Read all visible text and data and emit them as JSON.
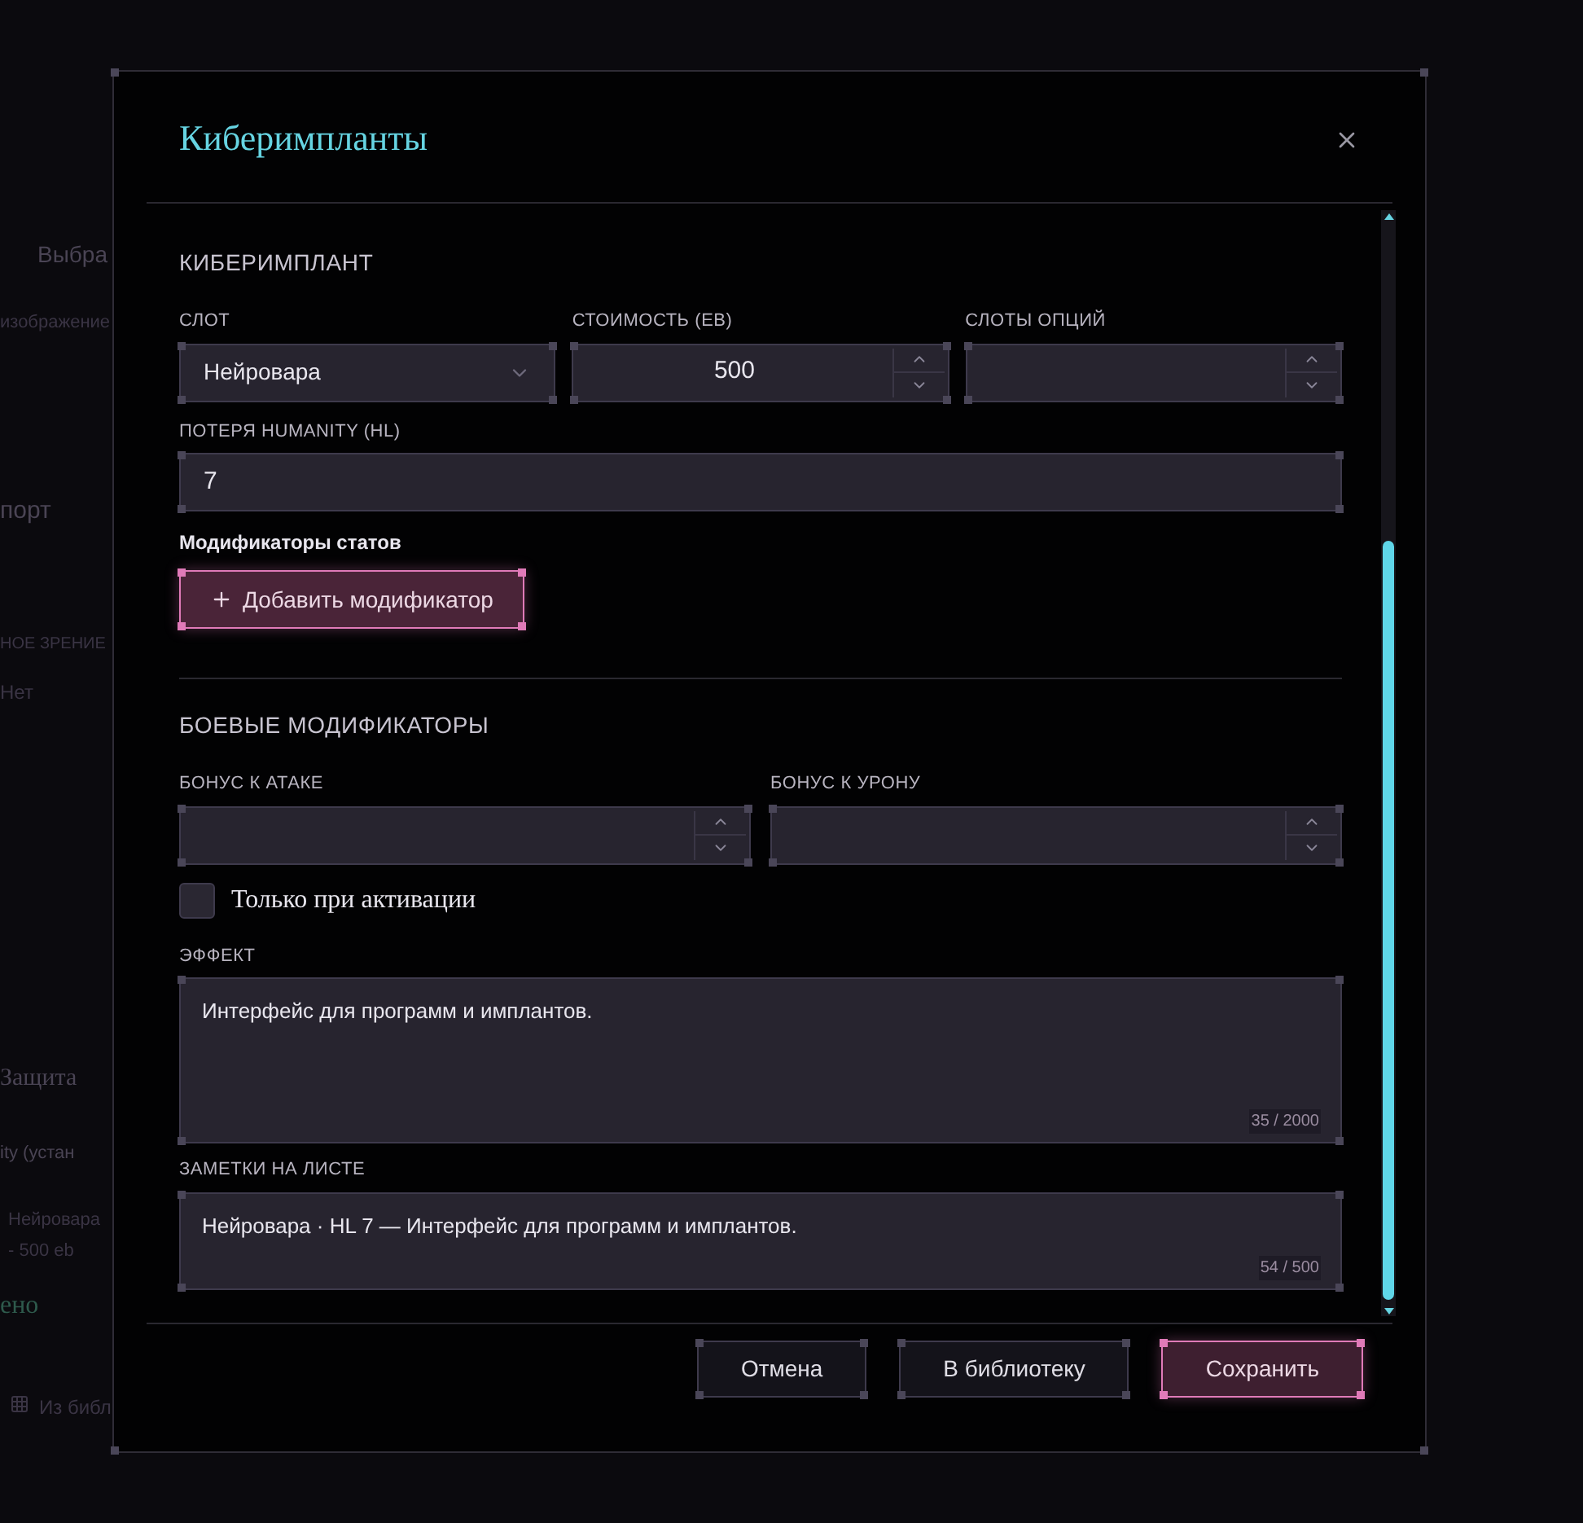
{
  "background": {
    "texts": [
      {
        "text": "Выбра"
      },
      {
        "text": "изображение"
      },
      {
        "text": "порт"
      },
      {
        "text": "НОЕ ЗРЕНИЕ"
      },
      {
        "text": "Нет"
      },
      {
        "text": "Защита"
      },
      {
        "text": "ity (устан"
      },
      {
        "text": "Нейровара"
      },
      {
        "text": "- 500 eb"
      },
      {
        "text": "ено"
      },
      {
        "text": "Из библ"
      }
    ]
  },
  "dialog": {
    "title": "Киберимпланты"
  },
  "implant": {
    "heading": "КИБЕРИМПЛАНТ",
    "slot": {
      "label": "СЛОТ",
      "value": "Нейровара"
    },
    "cost": {
      "label": "СТОИМОСТЬ (EB)",
      "value": "500"
    },
    "option_slots": {
      "label": "СЛОТЫ ОПЦИЙ"
    },
    "humanity_loss": {
      "label": "ПОТЕРЯ HUMANITY (HL)",
      "value": "7"
    },
    "stat_modifiers": {
      "label": "Модификаторы статов",
      "add_button": "Добавить модификатор"
    }
  },
  "combat": {
    "heading": "БОЕВЫЕ МОДИФИКАТОРЫ",
    "attack_bonus": {
      "label": "БОНУС К АТАКЕ"
    },
    "damage_bonus": {
      "label": "БОНУС К УРОНУ"
    },
    "activation_only": {
      "label": "Только при активации",
      "checked": false
    },
    "effect": {
      "label": "ЭФФЕКТ",
      "value": "Интерфейс для программ и имплантов.",
      "counter": "35 / 2000"
    },
    "sheet_notes": {
      "label": "ЗАМЕТКИ НА ЛИСТЕ",
      "value": "Нейровара · HL 7 — Интерфейс для программ и имплантов.",
      "counter": "54 / 500"
    }
  },
  "buttons": [
    {
      "label": "Отмена",
      "kind": "secondary"
    },
    {
      "label": "В библиотеку",
      "kind": "secondary"
    },
    {
      "label": "Сохранить",
      "kind": "primary"
    }
  ]
}
